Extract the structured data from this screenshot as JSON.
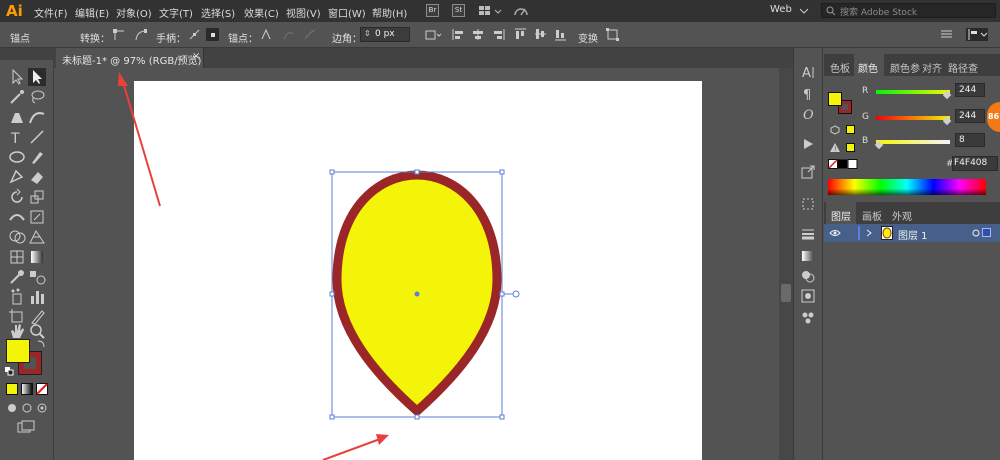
{
  "app": {
    "logo": "Ai"
  },
  "menu": {
    "items": [
      "文件(F)",
      "编辑(E)",
      "对象(O)",
      "文字(T)",
      "选择(S)",
      "效果(C)",
      "视图(V)",
      "窗口(W)",
      "帮助(H)"
    ],
    "br_label": "Br",
    "st_label": "St",
    "workspace": "Web",
    "search_placeholder": "搜索 Adobe Stock"
  },
  "control": {
    "anchor_label": "锚点",
    "convert_label": "转换：",
    "handle_label": "手柄：",
    "anchor_points_label": "锚点：",
    "corner_label": "边角：",
    "corner_value": "0 px",
    "transform_label": "变换"
  },
  "document": {
    "tab_label": "未标题-1* @ 97% (RGB/预览)",
    "tab_close": "×"
  },
  "color_panel": {
    "tabs": [
      "色板",
      "颜色",
      "颜色参",
      "对齐",
      "路径查"
    ],
    "active_tab": "颜色",
    "channels": [
      {
        "name": "R",
        "value": "244",
        "fraction": 0.957
      },
      {
        "name": "G",
        "value": "244",
        "fraction": 0.957
      },
      {
        "name": "B",
        "value": "8",
        "fraction": 0.031
      }
    ],
    "hex_symbol": "#",
    "hex": "F4F408",
    "fill_color": "#f4f408",
    "stroke_color": "#9b2628"
  },
  "layers_panel": {
    "tabs": [
      "图层",
      "画板",
      "外观"
    ],
    "active_tab": "图层",
    "layers": [
      {
        "name": "图层 1"
      }
    ]
  },
  "badge": {
    "text": "86"
  },
  "shape": {
    "fill": "#f4f408",
    "stroke": "#9b2628"
  }
}
